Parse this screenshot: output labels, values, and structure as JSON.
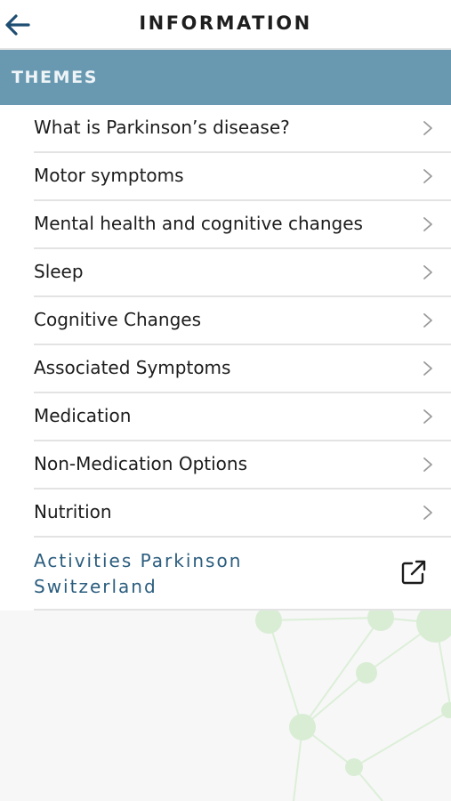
{
  "header": {
    "title": "INFORMATION",
    "back_icon": "arrow-left-icon"
  },
  "section": {
    "title": "THEMES",
    "color": "#6899b1"
  },
  "themes": [
    {
      "label": "What is Parkinson’s disease?",
      "icon": "chevron-right-icon"
    },
    {
      "label": "Motor symptoms",
      "icon": "chevron-right-icon"
    },
    {
      "label": "Mental health and cognitive changes",
      "icon": "chevron-right-icon"
    },
    {
      "label": "Sleep",
      "icon": "chevron-right-icon"
    },
    {
      "label": "Cognitive Changes",
      "icon": "chevron-right-icon"
    },
    {
      "label": "Associated Symptoms",
      "icon": "chevron-right-icon"
    },
    {
      "label": "Medication",
      "icon": "chevron-right-icon"
    },
    {
      "label": "Non-Medication Options",
      "icon": "chevron-right-icon"
    },
    {
      "label": "Nutrition",
      "icon": "chevron-right-icon"
    }
  ],
  "external_link": {
    "label": "Activities Parkinson Switzerland",
    "icon": "external-link-icon",
    "color": "#2b5d7e"
  },
  "decoration": {
    "icon": "network-graphic",
    "color": "#d8ecd4"
  }
}
